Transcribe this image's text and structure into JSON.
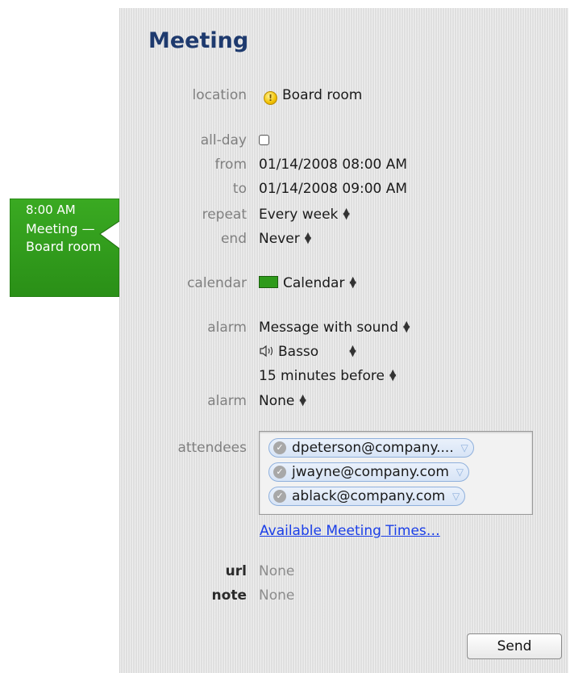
{
  "event": {
    "time": "8:00 AM",
    "line1": "Meeting —",
    "line2": "Board room"
  },
  "title": "Meeting",
  "fields": {
    "location_label": "location",
    "location_value": "Board room",
    "allday_label": "all-day",
    "from_label": "from",
    "from_value": "01/14/2008 08:00 AM",
    "to_label": "to",
    "to_value": "01/14/2008 09:00 AM",
    "repeat_label": "repeat",
    "repeat_value": "Every week",
    "end_label": "end",
    "end_value": "Never",
    "calendar_label": "calendar",
    "calendar_value": "Calendar",
    "alarm_label": "alarm",
    "alarm_value": "Message with sound",
    "alarm_sound": "Basso",
    "alarm_time": "15 minutes before",
    "alarm2_label": "alarm",
    "alarm2_value": "None",
    "attendees_label": "attendees",
    "url_label": "url",
    "url_value": "None",
    "note_label": "note",
    "note_value": "None"
  },
  "attendees": [
    "dpeterson@company....",
    "jwayne@company.com",
    "ablack@company.com"
  ],
  "available_times_link": "Available Meeting Times…",
  "send_label": "Send",
  "colors": {
    "event_green": "#2e9a1a",
    "title_blue": "#1e3a6e",
    "link_blue": "#1a3ee8"
  }
}
